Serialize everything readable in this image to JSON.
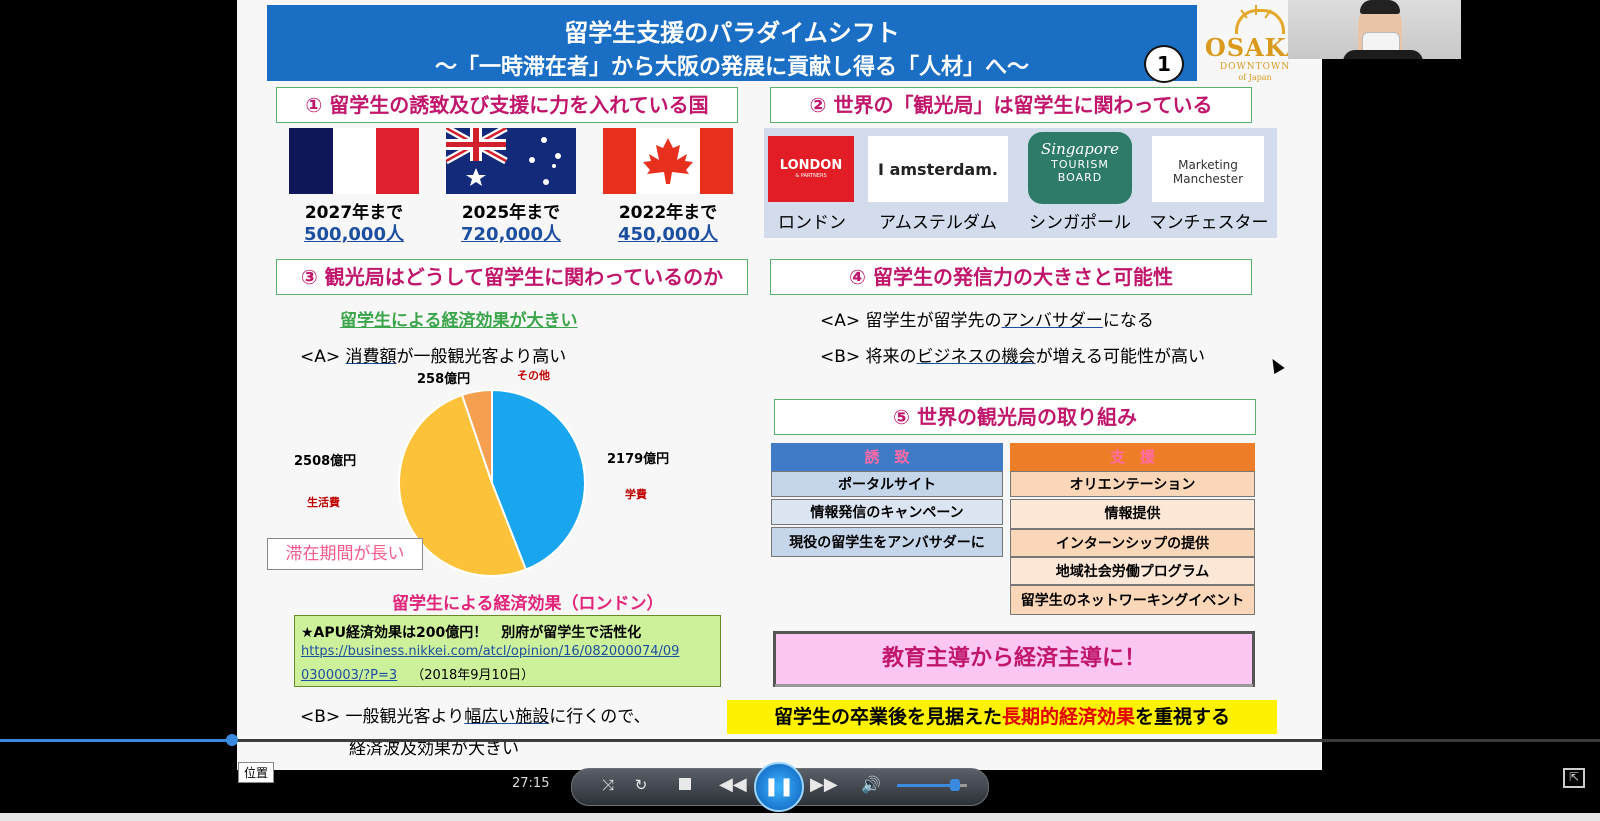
{
  "slide": {
    "title_line1": "留学生支援のパラダイムシフト",
    "title_line2": "～「一時滞在者」から大阪の発展に貢献し得る「人材」へ～",
    "page_badge": "1",
    "logo": {
      "word": "OSAKA",
      "sub1": "DOWNTOWN",
      "sub2": "of Japan"
    },
    "section1": {
      "heading": "① 留学生の誘致及び支援に力を入れている国",
      "countries": [
        {
          "flag_icon": "france-flag-icon",
          "label": "2027年まで",
          "value": "500,000人"
        },
        {
          "flag_icon": "australia-flag-icon",
          "label": "2025年まで",
          "value": "720,000人"
        },
        {
          "flag_icon": "canada-flag-icon",
          "label": "2022年まで",
          "value": "450,000人"
        }
      ]
    },
    "section2": {
      "heading": "② 世界の「観光局」は留学生に関わっている",
      "bureaus": [
        {
          "logo_text": "LONDON",
          "logo_sub": "& PARTNERS",
          "name": "ロンドン"
        },
        {
          "logo_text": "I amsterdam.",
          "name": "アムステルダム"
        },
        {
          "logo_text": "Singapore",
          "logo_sub1": "TOURISM",
          "logo_sub2": "BOARD",
          "name": "シンガポール"
        },
        {
          "logo_text": "Marketing",
          "logo_sub": "Manchester",
          "name": "マンチェスター"
        }
      ]
    },
    "section3": {
      "heading": "③ 観光局はどうして留学生に関わっているのか",
      "subheading": "留学生による経済効果が大きい",
      "point_a_prefix": "<A> ",
      "point_a_underlined": "消費額",
      "point_a_suffix": "が一般観光客より高い",
      "stay_box": "滞在期間が長い",
      "chart_title": "留学生による経済効果（ロンドン）",
      "apu_line1": "★APU経済効果は200億円！　別府が留学生で活性化",
      "apu_link1": "https://business.nikkei.com/atcl/opinion/16/082000074/09",
      "apu_link2": "0300003/?P=3",
      "apu_date": "（2018年9月10日）",
      "point_b_prefix": "<B> 一般観光客より",
      "point_b_underlined": "幅広い施設",
      "point_b_suffix": "に行くので、",
      "point_b_line2": "経済波及効果が大きい"
    },
    "section4": {
      "heading": "④ 留学生の発信力の大きさと可能性",
      "point_a_prefix": "<A> 留学生が留学先の",
      "point_a_underlined": "アンバサダー",
      "point_a_suffix": "になる",
      "point_b_prefix": "<B> 将来の",
      "point_b_underlined": "ビジネスの機会",
      "point_b_suffix": "が増える可能性が高い"
    },
    "section5": {
      "heading": "⑤ 世界の観光局の取り組み",
      "attract_header": "誘　致",
      "attract_items": [
        "ポータルサイト",
        "情報発信のキャンペーン",
        "現役の留学生をアンバサダーに"
      ],
      "support_header": "支　援",
      "support_items": [
        "オリエンテーション",
        "情報提供",
        "インターンシップの提供",
        "地域社会労働プログラム",
        "留学生のネットワーキングイベント"
      ],
      "econ_box": "教育主導から経済主導に！",
      "footer_prefix": "留学生の卒業後を見据えた",
      "footer_red": "長期的経済効果",
      "footer_suffix": "を重視する"
    }
  },
  "chart_data": {
    "type": "pie",
    "title": "留学生による経済効果（ロンドン）",
    "unit": "億円",
    "slices": [
      {
        "label": "学費",
        "value": 2179,
        "value_label": "2179億円",
        "color": "#1aa6ee"
      },
      {
        "label": "生活費",
        "value": 2508,
        "value_label": "2508億円",
        "color": "#fbc23a"
      },
      {
        "label": "その他",
        "value": 258,
        "value_label": "258億円",
        "color": "#f5a050"
      }
    ]
  },
  "player": {
    "time": "27:15",
    "tooltip": "位置",
    "progress": 0.145,
    "volume": 0.83,
    "icons": [
      "shuffle-icon",
      "repeat-icon",
      "stop-icon",
      "rewind-icon",
      "pause-icon",
      "fast-forward-icon",
      "volume-icon",
      "expand-icon"
    ]
  },
  "colors": {
    "header_blue": "#1a6fc4",
    "heading_magenta": "#c0166c",
    "table_blue": "#3f7bc7",
    "table_orange": "#ed7d27"
  }
}
